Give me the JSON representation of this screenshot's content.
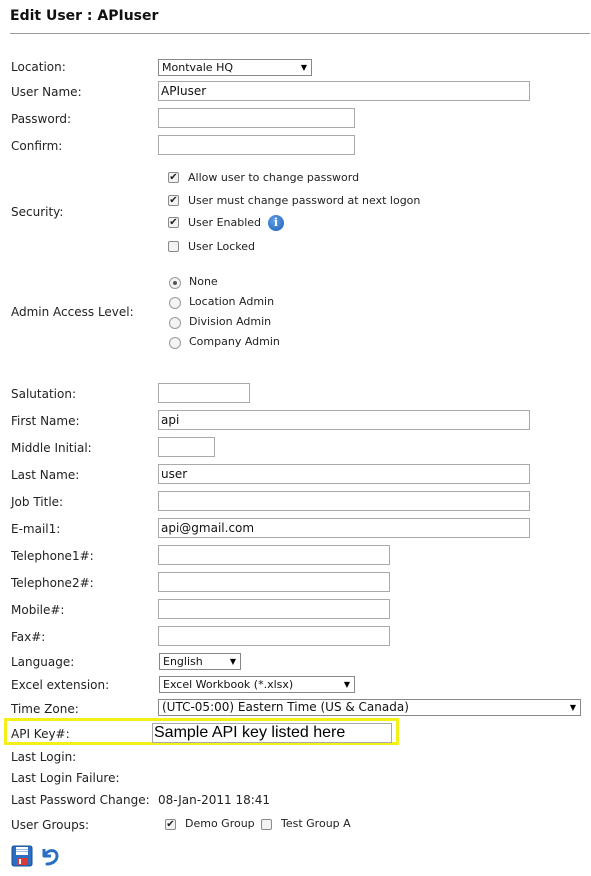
{
  "page": {
    "title": "Edit User : APIuser"
  },
  "labels": {
    "location": "Location:",
    "username": "User Name:",
    "password": "Password:",
    "confirm": "Confirm:",
    "security": "Security:",
    "admin_access": "Admin Access Level:",
    "salutation": "Salutation:",
    "first_name": "First Name:",
    "middle_initial": "Middle Initial:",
    "last_name": "Last Name:",
    "job_title": "Job Title:",
    "email1": "E-mail1:",
    "telephone1": "Telephone1#:",
    "telephone2": "Telephone2#:",
    "mobile": "Mobile#:",
    "fax": "Fax#:",
    "language": "Language:",
    "excel_extension": "Excel extension:",
    "time_zone": "Time Zone:",
    "api_key": "API Key#:",
    "last_login": "Last Login:",
    "last_login_failure": "Last Login Failure:",
    "last_password_change": "Last Password Change:",
    "user_groups": "User Groups:"
  },
  "values": {
    "location": "Montvale HQ",
    "username": "APIuser",
    "password": "",
    "confirm": "",
    "salutation": "",
    "first_name": "api",
    "middle_initial": "",
    "last_name": "user",
    "job_title": "",
    "email1": "api@gmail.com",
    "telephone1": "",
    "telephone2": "",
    "mobile": "",
    "fax": "",
    "language": "English",
    "excel_extension": "Excel Workbook (*.xlsx)",
    "time_zone": "(UTC-05:00) Eastern Time (US & Canada)",
    "api_key": "Sample API key listed here",
    "last_login": "",
    "last_login_failure": "",
    "last_password_change": "08-Jan-2011 18:41"
  },
  "security": [
    {
      "label": "Allow user to change password",
      "checked": true
    },
    {
      "label": "User must change password at next logon",
      "checked": true
    },
    {
      "label": "User Enabled",
      "checked": true
    },
    {
      "label": "User Locked",
      "checked": false
    }
  ],
  "admin_levels": [
    {
      "label": "None",
      "selected": true
    },
    {
      "label": "Location Admin",
      "selected": false
    },
    {
      "label": "Division Admin",
      "selected": false
    },
    {
      "label": "Company Admin",
      "selected": false
    }
  ],
  "user_groups": [
    {
      "label": "Demo Group",
      "checked": true
    },
    {
      "label": "Test Group A",
      "checked": false
    }
  ],
  "icons": {
    "info": "info-icon",
    "save": "save-icon",
    "undo": "undo-icon"
  },
  "colors": {
    "highlight": "#f5ef19",
    "info_blue": "#1b5fb8",
    "save_blue": "#2a6fc4"
  }
}
